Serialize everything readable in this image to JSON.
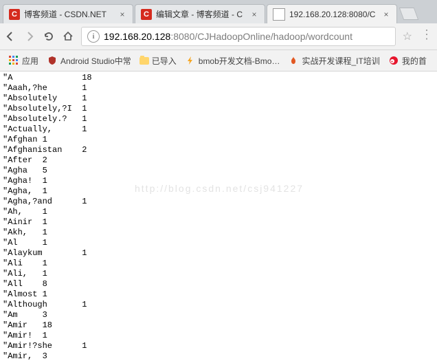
{
  "tabs": [
    {
      "title": "博客频道 - CSDN.NET",
      "favicon": "csdn"
    },
    {
      "title": "编辑文章 - 博客频道 - C",
      "favicon": "csdn"
    },
    {
      "title": "192.168.20.128:8080/C",
      "favicon": "page",
      "active": true
    }
  ],
  "nav": {
    "back": "←",
    "forward": "→",
    "reload": "↻",
    "home": "⌂"
  },
  "url": {
    "host": "192.168.20.128",
    "port_path": ":8080/CJHadoopOnline/hadoop/wordcount"
  },
  "bookmarks": [
    {
      "label": "应用",
      "icon": "apps"
    },
    {
      "label": "Android Studio中常",
      "icon": "shield"
    },
    {
      "label": "已导入",
      "icon": "folder"
    },
    {
      "label": "bmob开发文档-Bmo…",
      "icon": "bolt"
    },
    {
      "label": "实战开发课程_IT培训",
      "icon": "flame"
    },
    {
      "label": "我的首",
      "icon": "weibo"
    }
  ],
  "wordcount": [
    {
      "w": "\"A",
      "c": 18
    },
    {
      "w": "\"Aaah,?he",
      "c": 1
    },
    {
      "w": "\"Absolutely",
      "c": 1
    },
    {
      "w": "\"Absolutely,?I",
      "c": 1
    },
    {
      "w": "\"Absolutely.?",
      "c": 1
    },
    {
      "w": "\"Actually,",
      "c": 1
    },
    {
      "w": "\"Afghan",
      "c": 1,
      "short": true
    },
    {
      "w": "\"Afghanistan",
      "c": 2
    },
    {
      "w": "\"After",
      "c": 2,
      "short": true
    },
    {
      "w": "\"Agha",
      "c": 5,
      "short": true
    },
    {
      "w": "\"Agha!",
      "c": 1,
      "short": true
    },
    {
      "w": "\"Agha,",
      "c": 1,
      "short": true
    },
    {
      "w": "\"Agha,?and",
      "c": 1
    },
    {
      "w": "\"Ah,",
      "c": 1,
      "short": true
    },
    {
      "w": "\"Ainir",
      "c": 1,
      "short": true
    },
    {
      "w": "\"Akh,",
      "c": 1,
      "short": true
    },
    {
      "w": "\"Al",
      "c": 1,
      "short": true
    },
    {
      "w": "\"Alaykum",
      "c": 1
    },
    {
      "w": "\"Ali",
      "c": 1,
      "short": true
    },
    {
      "w": "\"Ali,",
      "c": 1,
      "short": true
    },
    {
      "w": "\"All",
      "c": 8,
      "short": true
    },
    {
      "w": "\"Almost",
      "c": 1,
      "short": true
    },
    {
      "w": "\"Although",
      "c": 1
    },
    {
      "w": "\"Am",
      "c": 3,
      "short": true
    },
    {
      "w": "\"Amir",
      "c": 18,
      "short": true
    },
    {
      "w": "\"Amir!",
      "c": 1,
      "short": true
    },
    {
      "w": "\"Amir!?she",
      "c": 1
    },
    {
      "w": "\"Amir,",
      "c": 3,
      "short": true
    }
  ],
  "watermark": "http://blog.csdn.net/csj941227"
}
